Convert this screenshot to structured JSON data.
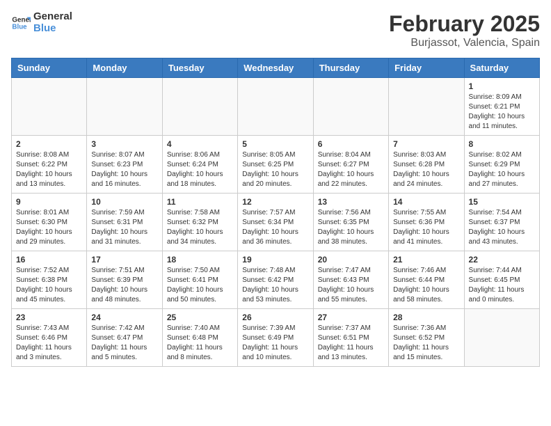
{
  "header": {
    "logo_general": "General",
    "logo_blue": "Blue",
    "month_title": "February 2025",
    "location": "Burjassot, Valencia, Spain"
  },
  "weekdays": [
    "Sunday",
    "Monday",
    "Tuesday",
    "Wednesday",
    "Thursday",
    "Friday",
    "Saturday"
  ],
  "weeks": [
    [
      {
        "day": "",
        "info": ""
      },
      {
        "day": "",
        "info": ""
      },
      {
        "day": "",
        "info": ""
      },
      {
        "day": "",
        "info": ""
      },
      {
        "day": "",
        "info": ""
      },
      {
        "day": "",
        "info": ""
      },
      {
        "day": "1",
        "info": "Sunrise: 8:09 AM\nSunset: 6:21 PM\nDaylight: 10 hours\nand 11 minutes."
      }
    ],
    [
      {
        "day": "2",
        "info": "Sunrise: 8:08 AM\nSunset: 6:22 PM\nDaylight: 10 hours\nand 13 minutes."
      },
      {
        "day": "3",
        "info": "Sunrise: 8:07 AM\nSunset: 6:23 PM\nDaylight: 10 hours\nand 16 minutes."
      },
      {
        "day": "4",
        "info": "Sunrise: 8:06 AM\nSunset: 6:24 PM\nDaylight: 10 hours\nand 18 minutes."
      },
      {
        "day": "5",
        "info": "Sunrise: 8:05 AM\nSunset: 6:25 PM\nDaylight: 10 hours\nand 20 minutes."
      },
      {
        "day": "6",
        "info": "Sunrise: 8:04 AM\nSunset: 6:27 PM\nDaylight: 10 hours\nand 22 minutes."
      },
      {
        "day": "7",
        "info": "Sunrise: 8:03 AM\nSunset: 6:28 PM\nDaylight: 10 hours\nand 24 minutes."
      },
      {
        "day": "8",
        "info": "Sunrise: 8:02 AM\nSunset: 6:29 PM\nDaylight: 10 hours\nand 27 minutes."
      }
    ],
    [
      {
        "day": "9",
        "info": "Sunrise: 8:01 AM\nSunset: 6:30 PM\nDaylight: 10 hours\nand 29 minutes."
      },
      {
        "day": "10",
        "info": "Sunrise: 7:59 AM\nSunset: 6:31 PM\nDaylight: 10 hours\nand 31 minutes."
      },
      {
        "day": "11",
        "info": "Sunrise: 7:58 AM\nSunset: 6:32 PM\nDaylight: 10 hours\nand 34 minutes."
      },
      {
        "day": "12",
        "info": "Sunrise: 7:57 AM\nSunset: 6:34 PM\nDaylight: 10 hours\nand 36 minutes."
      },
      {
        "day": "13",
        "info": "Sunrise: 7:56 AM\nSunset: 6:35 PM\nDaylight: 10 hours\nand 38 minutes."
      },
      {
        "day": "14",
        "info": "Sunrise: 7:55 AM\nSunset: 6:36 PM\nDaylight: 10 hours\nand 41 minutes."
      },
      {
        "day": "15",
        "info": "Sunrise: 7:54 AM\nSunset: 6:37 PM\nDaylight: 10 hours\nand 43 minutes."
      }
    ],
    [
      {
        "day": "16",
        "info": "Sunrise: 7:52 AM\nSunset: 6:38 PM\nDaylight: 10 hours\nand 45 minutes."
      },
      {
        "day": "17",
        "info": "Sunrise: 7:51 AM\nSunset: 6:39 PM\nDaylight: 10 hours\nand 48 minutes."
      },
      {
        "day": "18",
        "info": "Sunrise: 7:50 AM\nSunset: 6:41 PM\nDaylight: 10 hours\nand 50 minutes."
      },
      {
        "day": "19",
        "info": "Sunrise: 7:48 AM\nSunset: 6:42 PM\nDaylight: 10 hours\nand 53 minutes."
      },
      {
        "day": "20",
        "info": "Sunrise: 7:47 AM\nSunset: 6:43 PM\nDaylight: 10 hours\nand 55 minutes."
      },
      {
        "day": "21",
        "info": "Sunrise: 7:46 AM\nSunset: 6:44 PM\nDaylight: 10 hours\nand 58 minutes."
      },
      {
        "day": "22",
        "info": "Sunrise: 7:44 AM\nSunset: 6:45 PM\nDaylight: 11 hours\nand 0 minutes."
      }
    ],
    [
      {
        "day": "23",
        "info": "Sunrise: 7:43 AM\nSunset: 6:46 PM\nDaylight: 11 hours\nand 3 minutes."
      },
      {
        "day": "24",
        "info": "Sunrise: 7:42 AM\nSunset: 6:47 PM\nDaylight: 11 hours\nand 5 minutes."
      },
      {
        "day": "25",
        "info": "Sunrise: 7:40 AM\nSunset: 6:48 PM\nDaylight: 11 hours\nand 8 minutes."
      },
      {
        "day": "26",
        "info": "Sunrise: 7:39 AM\nSunset: 6:49 PM\nDaylight: 11 hours\nand 10 minutes."
      },
      {
        "day": "27",
        "info": "Sunrise: 7:37 AM\nSunset: 6:51 PM\nDaylight: 11 hours\nand 13 minutes."
      },
      {
        "day": "28",
        "info": "Sunrise: 7:36 AM\nSunset: 6:52 PM\nDaylight: 11 hours\nand 15 minutes."
      },
      {
        "day": "",
        "info": ""
      }
    ]
  ]
}
